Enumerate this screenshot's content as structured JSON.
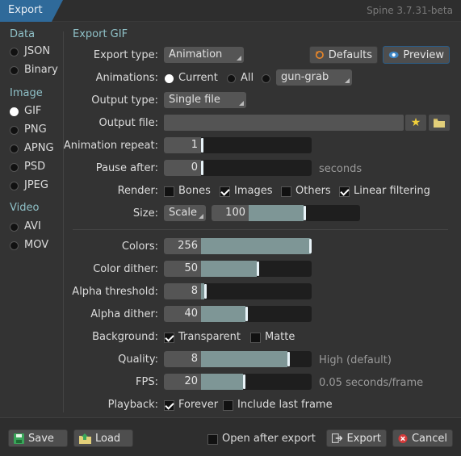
{
  "window": {
    "tab_title": "Export",
    "version": "Spine 3.7.31-beta"
  },
  "sidebar": {
    "groups": [
      {
        "heading": "Data",
        "items": [
          {
            "label": "JSON",
            "selected": false
          },
          {
            "label": "Binary",
            "selected": false
          }
        ]
      },
      {
        "heading": "Image",
        "items": [
          {
            "label": "GIF",
            "selected": true
          },
          {
            "label": "PNG",
            "selected": false
          },
          {
            "label": "APNG",
            "selected": false
          },
          {
            "label": "PSD",
            "selected": false
          },
          {
            "label": "JPEG",
            "selected": false
          }
        ]
      },
      {
        "heading": "Video",
        "items": [
          {
            "label": "AVI",
            "selected": false
          },
          {
            "label": "MOV",
            "selected": false
          }
        ]
      }
    ]
  },
  "form": {
    "section_title": "Export GIF",
    "export_type": {
      "label": "Export type:",
      "value": "Animation"
    },
    "defaults_button": "Defaults",
    "preview_button": "Preview",
    "animations": {
      "label": "Animations:",
      "current_label": "Current",
      "all_label": "All",
      "selected": "current",
      "animation_value": "gun-grab"
    },
    "output_type": {
      "label": "Output type:",
      "value": "Single file"
    },
    "output_file": {
      "label": "Output file:",
      "value": ""
    },
    "animation_repeat": {
      "label": "Animation repeat:",
      "value": "1",
      "fraction": 0.0
    },
    "pause_after": {
      "label": "Pause after:",
      "value": "0",
      "fraction": 0.0,
      "unit": "seconds"
    },
    "render": {
      "label": "Render:",
      "bones": "Bones",
      "images": "Images",
      "others": "Others",
      "linear": "Linear filtering",
      "bones_checked": false,
      "images_checked": true,
      "others_checked": false,
      "linear_checked": true
    },
    "size": {
      "label": "Size:",
      "mode": "Scale",
      "value": "100",
      "fraction": 0.49
    },
    "colors": {
      "label": "Colors:",
      "value": "256",
      "fraction": 1.0
    },
    "color_dither": {
      "label": "Color dither:",
      "value": "50",
      "fraction": 0.5
    },
    "alpha_threshold": {
      "label": "Alpha threshold:",
      "value": "8",
      "fraction": 0.03
    },
    "alpha_dither": {
      "label": "Alpha dither:",
      "value": "40",
      "fraction": 0.4
    },
    "background": {
      "label": "Background:",
      "transparent": "Transparent",
      "matte": "Matte",
      "transparent_checked": true,
      "matte_checked": false
    },
    "quality": {
      "label": "Quality:",
      "value": "8",
      "fraction": 0.78,
      "hint": "High (default)"
    },
    "fps": {
      "label": "FPS:",
      "value": "20",
      "fraction": 0.38,
      "hint": "0.05 seconds/frame"
    },
    "playback": {
      "label": "Playback:",
      "forever": "Forever",
      "include_last": "Include last frame",
      "forever_checked": true,
      "include_last_checked": false
    }
  },
  "footer": {
    "save": "Save",
    "load": "Load",
    "open_after": "Open after export",
    "open_after_checked": false,
    "export": "Export",
    "cancel": "Cancel"
  },
  "colors": {
    "accent": "#2f6a9a",
    "heading": "#8fc1c8",
    "slider_fill": "#7e9696",
    "background": "#333333"
  }
}
